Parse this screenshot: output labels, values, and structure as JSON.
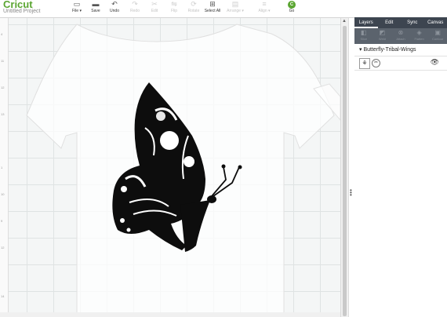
{
  "app": {
    "logo": "Cricut",
    "project_name": "Untitled Project"
  },
  "toolbar": [
    {
      "label": "File ▾",
      "icon": "▭",
      "disabled": false
    },
    {
      "label": "Save",
      "icon": "▬",
      "disabled": false
    },
    {
      "label": "Undo",
      "icon": "↶",
      "disabled": false
    },
    {
      "label": "Redo",
      "icon": "↷",
      "disabled": true
    },
    {
      "label": "Edit",
      "icon": "✂",
      "disabled": true
    },
    {
      "label": "Flip",
      "icon": "⇋",
      "disabled": true
    },
    {
      "label": "Rotate",
      "icon": "⟳",
      "disabled": true
    },
    {
      "label": "Select All",
      "icon": "⊞",
      "disabled": false
    },
    {
      "label": "Arrange ▾",
      "icon": "▤",
      "disabled": true
    },
    {
      "label": "Align ▾",
      "icon": "≡",
      "disabled": true
    }
  ],
  "go_button": {
    "label": "Go",
    "badge": "C"
  },
  "ruler": [
    "4",
    "11",
    "12",
    "13",
    "1",
    "10",
    "9",
    "12",
    "14"
  ],
  "panel": {
    "tabs": [
      "Layers",
      "Edit",
      "Sync",
      "Canvas"
    ],
    "actions": [
      "Slice",
      "Weld",
      "Attach",
      "Flatten",
      "Contour"
    ],
    "group_name": "Butterfly-Tribal-Wings"
  },
  "colors": {
    "brand": "#5aa531",
    "panel_dark": "#3d4550"
  }
}
